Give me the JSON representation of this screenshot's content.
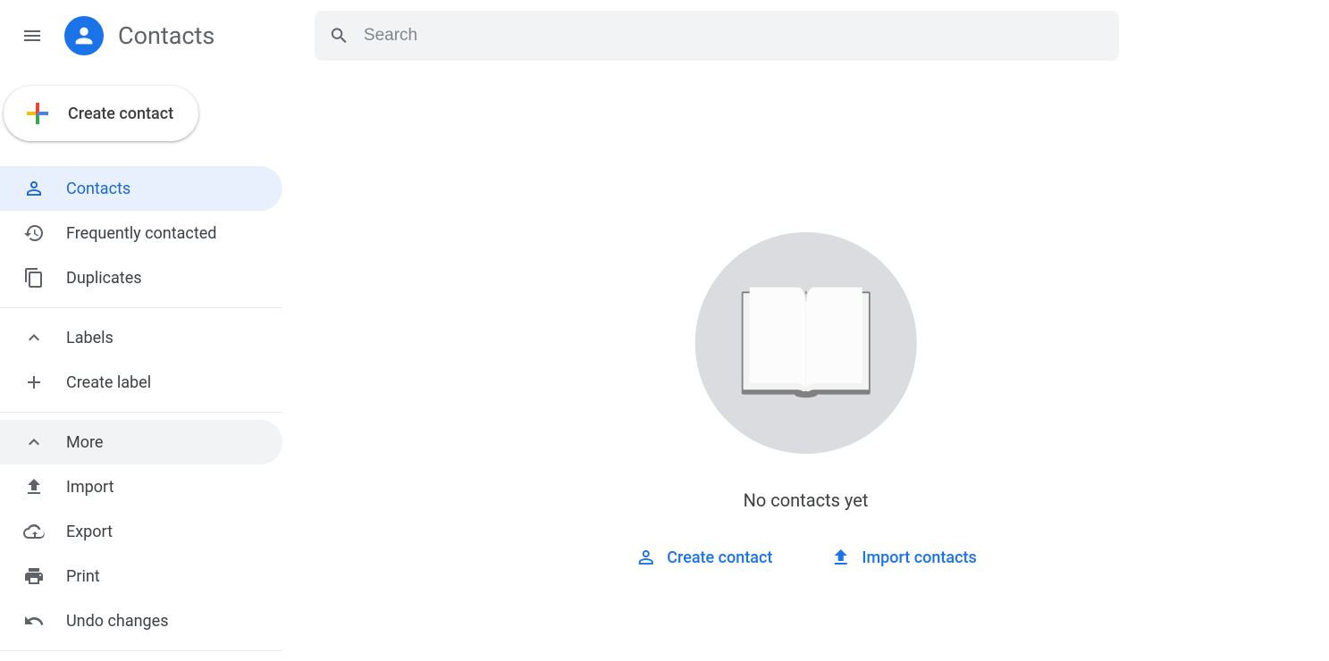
{
  "header": {
    "app_title": "Contacts",
    "search_placeholder": "Search"
  },
  "sidebar": {
    "create_label": "Create contact",
    "items": [
      {
        "label": "Contacts"
      },
      {
        "label": "Frequently contacted"
      },
      {
        "label": "Duplicates"
      }
    ],
    "labels_section": {
      "header": "Labels",
      "create": "Create label"
    },
    "more_section": {
      "header": "More",
      "items": [
        {
          "label": "Import"
        },
        {
          "label": "Export"
        },
        {
          "label": "Print"
        },
        {
          "label": "Undo changes"
        }
      ]
    }
  },
  "main": {
    "empty_message": "No contacts yet",
    "create_action": "Create contact",
    "import_action": "Import contacts"
  }
}
